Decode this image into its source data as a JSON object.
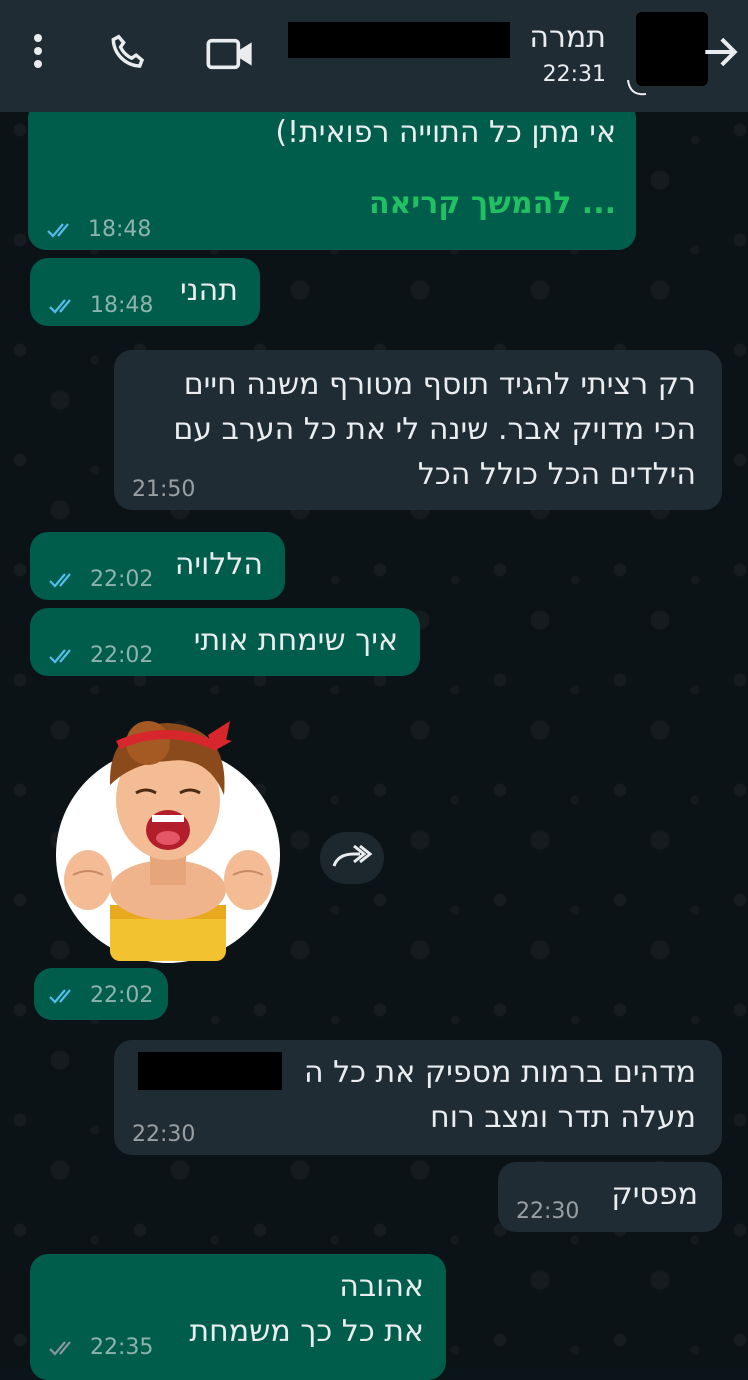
{
  "header": {
    "contact_name": "תמרה",
    "last_seen": "22:31",
    "icons": [
      "menu-dots-icon",
      "phone-icon",
      "video-call-icon",
      "back-arrow-icon"
    ]
  },
  "messages": [
    {
      "dir": "out",
      "text": "אי מתן כל התוייה רפואית!)",
      "extra": "... להמשך קריאה",
      "time": "18:48",
      "ticks": "read"
    },
    {
      "dir": "out",
      "text": "תהני",
      "time": "18:48",
      "ticks": "read"
    },
    {
      "dir": "in",
      "text": "רק רציתי להגיד תוסף מטורף משנה חיים\nהכי מדויק אבר. שינה לי את כל הערב עם\nהילדים הכל כולל הכל",
      "time": "21:50"
    },
    {
      "dir": "out",
      "text": "הללויה",
      "time": "22:02",
      "ticks": "read"
    },
    {
      "dir": "out",
      "text": "איך שימחת אותי",
      "time": "22:02",
      "ticks": "read"
    },
    {
      "dir": "out",
      "type": "sticker",
      "time": "22:02",
      "ticks": "read"
    },
    {
      "dir": "in",
      "text": "מדהים ברמות מספיק את כל ה\nמעלה תדר ומצב רוח",
      "time": "22:30"
    },
    {
      "dir": "in",
      "text": "מפסיק",
      "time": "22:30"
    },
    {
      "dir": "out",
      "text": "אהובה\nאת כל כך משמחת",
      "time": "22:35",
      "ticks": "read"
    }
  ],
  "colors": {
    "outgoing_bubble": "#005c4b",
    "incoming_bubble": "#202c33",
    "header": "#1f2c33",
    "read_ticks": "#53bdeb",
    "link": "#21c063"
  }
}
